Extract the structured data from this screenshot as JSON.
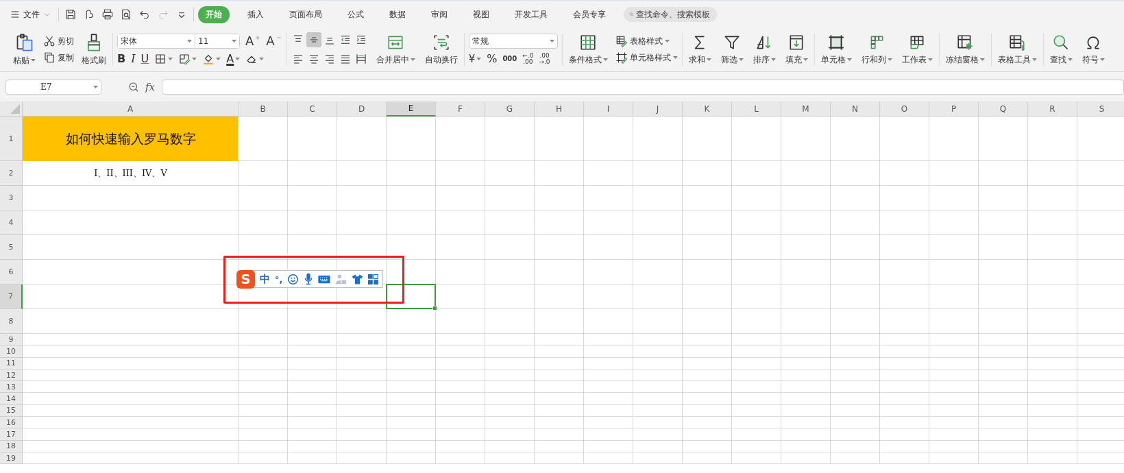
{
  "menu": {
    "label": "文件"
  },
  "quick_access": [
    {
      "disabled": false
    },
    {
      "disabled": false
    },
    {
      "disabled": false
    },
    {
      "disabled": false
    },
    {
      "disabled": false
    },
    {
      "disabled": true
    },
    {
      "disabled": false
    }
  ],
  "tabs": [
    {
      "label": "开始",
      "selected": true
    },
    {
      "label": "插入",
      "selected": false
    },
    {
      "label": "页面布局",
      "selected": false
    },
    {
      "label": "公式",
      "selected": false
    },
    {
      "label": "数据",
      "selected": false
    },
    {
      "label": "审阅",
      "selected": false
    },
    {
      "label": "视图",
      "selected": false
    },
    {
      "label": "开发工具",
      "selected": false
    },
    {
      "label": "会员专享",
      "selected": false
    }
  ],
  "search": {
    "placeholder": "查找命令、搜索模板"
  },
  "ribbon": {
    "clipboard": {
      "paste": {
        "label": "粘贴"
      },
      "cut": {
        "label": "剪切"
      },
      "copy": {
        "label": "复制"
      },
      "format_painter": {
        "label": "格式刷"
      }
    },
    "font": {
      "family": "宋体",
      "size": "11",
      "grow": "A",
      "shrink": "A",
      "bold": "B",
      "italic": "I",
      "underline": "U",
      "font_color": "A"
    },
    "alignment": {
      "buttons": [
        {
          "selected": false
        },
        {
          "selected": true
        },
        {
          "selected": false
        },
        {
          "selected": false
        },
        {
          "selected": false
        },
        {
          "selected": false
        },
        {
          "selected": false
        },
        {
          "selected": false
        },
        {
          "selected": false
        },
        {
          "selected": false
        }
      ],
      "merge": {
        "label": "合并居中"
      },
      "wrap": {
        "label": "自动换行"
      }
    },
    "number": {
      "format": "常规",
      "currency": "¥",
      "percent": "%",
      "thousands": "000",
      "increase_decimal": [
        "←.0",
        ".00"
      ],
      "decrease_decimal": [
        ".00",
        "→.0"
      ]
    },
    "styles": {
      "conditional": {
        "label": "条件格式"
      },
      "table_style": {
        "label": "表格样式"
      },
      "cell_style": {
        "label": "单元格样式"
      }
    },
    "groups": [
      {
        "buttons": [
          {
            "label": "求和"
          },
          {
            "label": "筛选"
          },
          {
            "label": "排序"
          },
          {
            "label": "填充"
          }
        ]
      },
      {
        "buttons": [
          {
            "label": "单元格"
          },
          {
            "label": "行和列"
          },
          {
            "label": "工作表"
          }
        ]
      },
      {
        "buttons": [
          {
            "label": "冻结窗格"
          }
        ]
      },
      {
        "buttons": [
          {
            "label": "表格工具"
          }
        ]
      },
      {
        "buttons": [
          {
            "label": "查找"
          },
          {
            "label": "符号"
          }
        ]
      }
    ]
  },
  "formula_bar": {
    "name_box": "E7",
    "fx": "fx"
  },
  "sheet": {
    "columns": [
      {
        "label": "A",
        "selected": false
      },
      {
        "label": "B",
        "selected": false
      },
      {
        "label": "C",
        "selected": false
      },
      {
        "label": "D",
        "selected": false
      },
      {
        "label": "E",
        "selected": true
      },
      {
        "label": "F",
        "selected": false
      },
      {
        "label": "G",
        "selected": false
      },
      {
        "label": "H",
        "selected": false
      },
      {
        "label": "I",
        "selected": false
      },
      {
        "label": "J",
        "selected": false
      },
      {
        "label": "K",
        "selected": false
      },
      {
        "label": "L",
        "selected": false
      },
      {
        "label": "M",
        "selected": false
      },
      {
        "label": "N",
        "selected": false
      },
      {
        "label": "O",
        "selected": false
      },
      {
        "label": "P",
        "selected": false
      },
      {
        "label": "Q",
        "selected": false
      },
      {
        "label": "R",
        "selected": false
      },
      {
        "label": "S",
        "selected": false
      }
    ],
    "rows": [
      {
        "label": "1",
        "selected": false,
        "cells": [
          {
            "kind": "title",
            "text": "如何快速输入罗马数字"
          }
        ]
      },
      {
        "label": "2",
        "selected": false,
        "cells": [
          {
            "kind": "plain",
            "text": "I、II、III、IV、V"
          }
        ]
      },
      {
        "label": "3",
        "selected": false
      },
      {
        "label": "4",
        "selected": false
      },
      {
        "label": "5",
        "selected": false
      },
      {
        "label": "6",
        "selected": false
      },
      {
        "label": "7",
        "selected": true
      },
      {
        "label": "8",
        "selected": false
      },
      {
        "label": "9",
        "selected": false
      },
      {
        "label": "10",
        "selected": false
      },
      {
        "label": "11",
        "selected": false
      },
      {
        "label": "12",
        "selected": false
      },
      {
        "label": "13",
        "selected": false
      },
      {
        "label": "14",
        "selected": false
      },
      {
        "label": "15",
        "selected": false
      },
      {
        "label": "16",
        "selected": false
      },
      {
        "label": "17",
        "selected": false
      },
      {
        "label": "18",
        "selected": false
      },
      {
        "label": "19",
        "selected": false
      }
    ]
  },
  "ime_toolbar": {
    "logo": "S",
    "mode": "中",
    "punctuation": "°,"
  }
}
